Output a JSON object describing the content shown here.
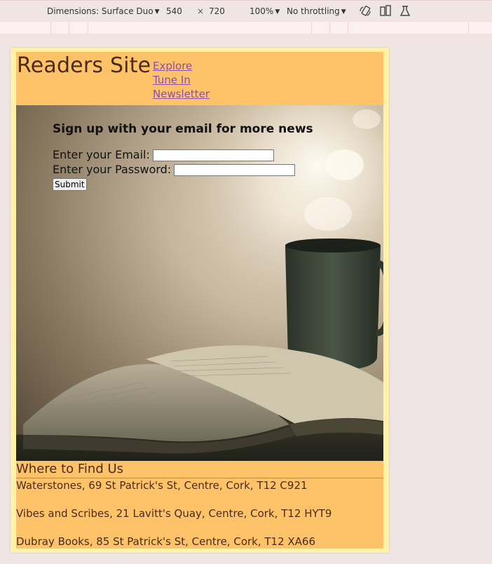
{
  "devtools": {
    "dimensions_label": "Dimensions: Surface Duo",
    "width": "540",
    "times": "×",
    "height": "720",
    "zoom": "100%",
    "throttling": "No throttling",
    "icons": [
      "rotate-icon",
      "dual-screen-icon",
      "sensors-icon"
    ]
  },
  "site": {
    "title": "Readers Site",
    "nav": [
      "Explore",
      "Tune In",
      "Newsletter"
    ]
  },
  "signup": {
    "heading": "Sign up with your email for more news",
    "email_label": "Enter your Email:",
    "email_value": "",
    "password_label": "Enter your Password:",
    "password_value": "",
    "submit_label": "Submit"
  },
  "locations": {
    "heading": "Where to Find Us",
    "items": [
      "Waterstones, 69 St Patrick's St, Centre, Cork, T12 C921",
      "Vibes and Scribes, 21 Lavitt's Quay, Centre, Cork, T12 HYT9",
      "Dubray Books, 85 St Patrick's St, Centre, Cork, T12 XA66"
    ]
  },
  "colors": {
    "page_background": "#fec268",
    "frame": "#fff2a8",
    "text": "#4a2b1c",
    "link": "#8a4fa6",
    "devtools_background": "#f0e5e5"
  }
}
